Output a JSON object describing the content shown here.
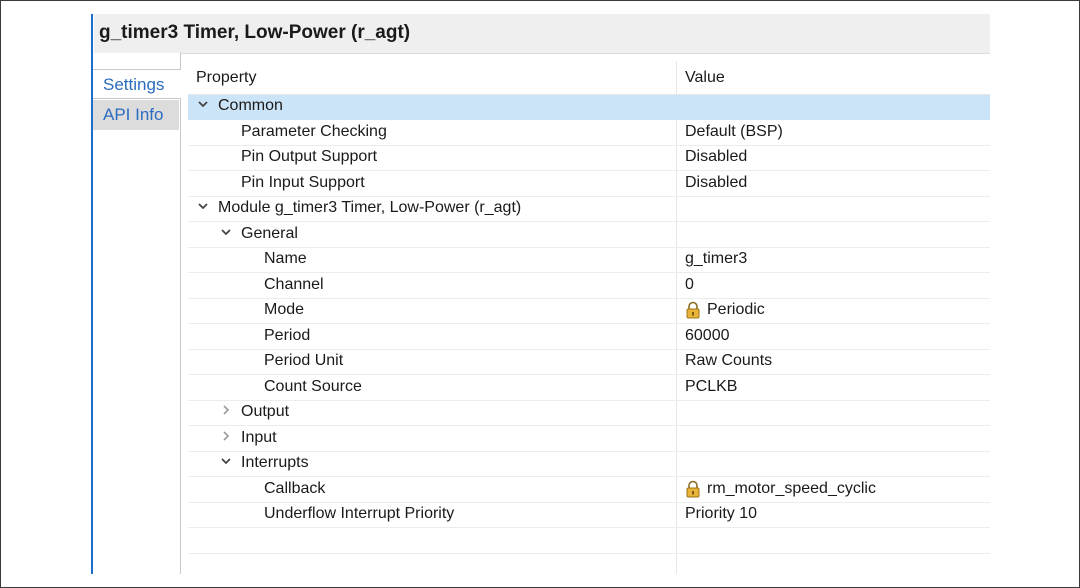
{
  "window": {
    "title": "g_timer3 Timer, Low-Power (r_agt)"
  },
  "tabs": [
    {
      "label": "Settings",
      "active": true
    },
    {
      "label": "API Info",
      "active": false
    }
  ],
  "table": {
    "headers": {
      "property": "Property",
      "value": "Value"
    },
    "rows": [
      {
        "level": 0,
        "expander": "open",
        "property": "Common",
        "value": "",
        "selected": true
      },
      {
        "level": 1,
        "expander": "none",
        "property": "Parameter Checking",
        "value": "Default (BSP)"
      },
      {
        "level": 1,
        "expander": "none",
        "property": "Pin Output Support",
        "value": "Disabled"
      },
      {
        "level": 1,
        "expander": "none",
        "property": "Pin Input Support",
        "value": "Disabled"
      },
      {
        "level": 0,
        "expander": "open",
        "property": "Module g_timer3 Timer, Low-Power (r_agt)",
        "value": ""
      },
      {
        "level": 1,
        "expander": "open",
        "property": "General",
        "value": ""
      },
      {
        "level": 2,
        "expander": "none",
        "property": "Name",
        "value": "g_timer3"
      },
      {
        "level": 2,
        "expander": "none",
        "property": "Channel",
        "value": "0"
      },
      {
        "level": 2,
        "expander": "none",
        "property": "Mode",
        "value": "Periodic",
        "icon": "lock-icon"
      },
      {
        "level": 2,
        "expander": "none",
        "property": "Period",
        "value": "60000"
      },
      {
        "level": 2,
        "expander": "none",
        "property": "Period Unit",
        "value": "Raw Counts"
      },
      {
        "level": 2,
        "expander": "none",
        "property": "Count Source",
        "value": "PCLKB"
      },
      {
        "level": 1,
        "expander": "closed",
        "property": "Output",
        "value": ""
      },
      {
        "level": 1,
        "expander": "closed",
        "property": "Input",
        "value": ""
      },
      {
        "level": 1,
        "expander": "open",
        "property": "Interrupts",
        "value": ""
      },
      {
        "level": 2,
        "expander": "none",
        "property": "Callback",
        "value": "rm_motor_speed_cyclic",
        "icon": "lock-icon"
      },
      {
        "level": 2,
        "expander": "none",
        "property": "Underflow Interrupt Priority",
        "value": "Priority 10"
      },
      {
        "level": 0,
        "expander": "none",
        "property": "",
        "value": ""
      }
    ]
  },
  "colors": {
    "selection": "#cce4f7",
    "tab_text": "#2a6cbf",
    "accent_rule": "#1e6fc8"
  }
}
